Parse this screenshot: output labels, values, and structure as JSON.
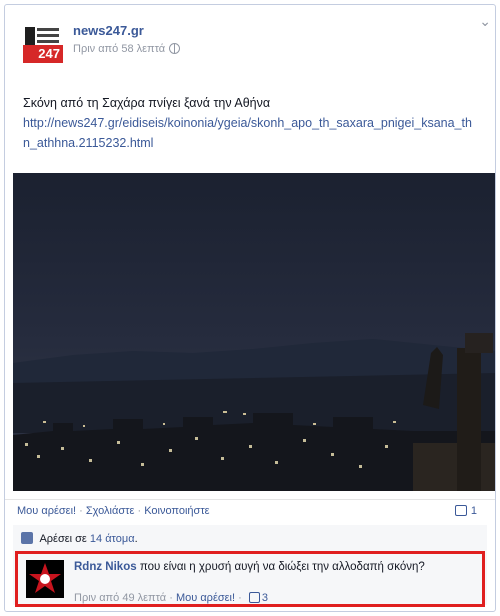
{
  "post": {
    "page_name": "news247.gr",
    "logo_text": "247",
    "time": "Πριν από 58 λεπτά",
    "text": "Σκόνη από τη Σαχάρα πνίγει ξανά την Αθήνα",
    "link": "http://news247.gr/eidiseis/koinonia/ygeia/skonh_apo_th_saxara_pnigei_ksana_thn_athhna.2115232.html"
  },
  "actions": {
    "like": "Μου αρέσει!",
    "comment": "Σχολιάστε",
    "share": "Κοινοποιήστε",
    "comment_count": "1"
  },
  "likes": {
    "prefix": "Αρέσει σε",
    "count": "14 άτομα",
    "suffix": "."
  },
  "comment": {
    "author": "Rdnz Nikos",
    "text": "που είναι η χρυσή αυγή να διώξει την αλλοδαπή σκόνη?",
    "time": "Πριν από 49 λεπτά",
    "like": "Μου αρέσει!",
    "likes": "3"
  },
  "colors": {
    "link": "#3b5998",
    "highlight": "#e01f1f",
    "logo_red": "#d62828"
  }
}
